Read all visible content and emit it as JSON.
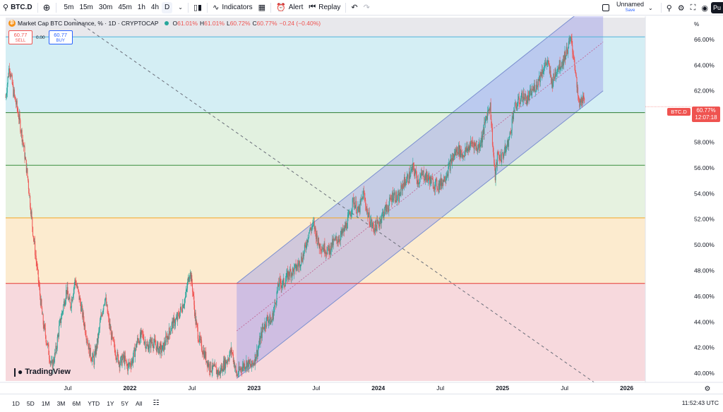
{
  "toolbar": {
    "symbol": "BTC.D",
    "intervals": [
      "5m",
      "15m",
      "30m",
      "45m",
      "1h",
      "4h",
      "D"
    ],
    "active_interval": "D",
    "indicators_label": "Indicators",
    "alert_label": "Alert",
    "replay_label": "Replay",
    "layout_name": "Unnamed",
    "save_label": "Save",
    "publish_label": "Pu"
  },
  "legend": {
    "title": "Market Cap BTC Dominance, % · 1D · CRYPTOCAP",
    "o_key": "O",
    "o_val": "61.01%",
    "h_key": "H",
    "h_val": "61.01%",
    "l_key": "L",
    "l_val": "60.72%",
    "c_key": "C",
    "c_val": "60.77%",
    "change": "−0.24 (−0.40%)"
  },
  "trade": {
    "sell_price": "60.77",
    "sell_label": "SELL",
    "spread": "0.00",
    "buy_price": "60.77",
    "buy_label": "BUY"
  },
  "watermark": "TradingView",
  "price_tag": {
    "symbol": "BTC.D",
    "value": "60.77%",
    "countdown": "12:07:18"
  },
  "bottom": {
    "ranges": [
      "1D",
      "5D",
      "1M",
      "3M",
      "6M",
      "YTD",
      "1Y",
      "5Y",
      "All"
    ],
    "utc_time": "11:52:43 UTC"
  },
  "colors": {
    "up": "#26a69a",
    "down": "#ef5350",
    "cyan_zone": "#d4eef4",
    "green_zone": "#e2f1e0",
    "orange_zone": "#fcebcf",
    "red_zone": "#f7d9dd",
    "channel_fill": "#9e9ee8",
    "channel_line": "#7b8fcf"
  },
  "chart_data": {
    "type": "candlestick",
    "unit_label": "%",
    "y_ticks": [
      "66.00%",
      "64.00%",
      "62.00%",
      "60.00%",
      "58.00%",
      "56.00%",
      "54.00%",
      "52.00%",
      "50.00%",
      "48.00%",
      "46.00%",
      "44.00%",
      "42.00%",
      "40.00%"
    ],
    "y_tick_values": [
      66,
      64,
      62,
      60,
      58,
      56,
      54,
      52,
      50,
      48,
      46,
      44,
      42,
      40
    ],
    "ylim": [
      39.4,
      67.7
    ],
    "x_ticks": [
      {
        "label": "Jul",
        "t": 2021.5
      },
      {
        "label": "2022",
        "t": 2022.0
      },
      {
        "label": "Jul",
        "t": 2022.5
      },
      {
        "label": "2023",
        "t": 2023.0
      },
      {
        "label": "Jul",
        "t": 2023.5
      },
      {
        "label": "2024",
        "t": 2024.0
      },
      {
        "label": "Jul",
        "t": 2024.5
      },
      {
        "label": "2025",
        "t": 2025.0
      },
      {
        "label": "Jul",
        "t": 2025.5
      },
      {
        "label": "2026",
        "t": 2026.0
      }
    ],
    "xlim": [
      2021.0,
      2026.15
    ],
    "horizontal_levels": [
      {
        "value": 66.2,
        "color": "#4fb3d9"
      },
      {
        "value": 60.3,
        "color": "#2e7d32"
      },
      {
        "value": 56.2,
        "color": "#388e3c"
      },
      {
        "value": 52.1,
        "color": "#f5a623"
      },
      {
        "value": 47.0,
        "color": "#e53935"
      }
    ],
    "zones": [
      {
        "from": 60.3,
        "to": 66.2,
        "color": "#d4eef4"
      },
      {
        "from": 56.2,
        "to": 60.3,
        "color": "#e2f1e0"
      },
      {
        "from": 52.1,
        "to": 56.2,
        "color": "#e6f2e0"
      },
      {
        "from": 47.0,
        "to": 52.1,
        "color": "#fcebcf"
      },
      {
        "from": 39.4,
        "to": 47.0,
        "color": "#f7d9dd"
      }
    ],
    "channel": {
      "t_start": 2022.86,
      "t_end": 2025.81,
      "upper_start": 47.0,
      "upper_end": 69.6,
      "lower_start": 39.6,
      "lower_end": 62.0
    },
    "diagonal_trend": {
      "t_start": 2021.55,
      "v_start": 67.6,
      "t_end": 2025.81,
      "v_end": 38.8
    },
    "series": [
      {
        "name": "BTC.D",
        "points": [
          [
            2021.0,
            61.5
          ],
          [
            2021.03,
            64.0
          ],
          [
            2021.06,
            62.0
          ],
          [
            2021.1,
            60.3
          ],
          [
            2021.14,
            58.0
          ],
          [
            2021.18,
            55.0
          ],
          [
            2021.22,
            51.0
          ],
          [
            2021.26,
            47.5
          ],
          [
            2021.3,
            44.0
          ],
          [
            2021.34,
            42.0
          ],
          [
            2021.37,
            40.5
          ],
          [
            2021.4,
            41.5
          ],
          [
            2021.43,
            43.5
          ],
          [
            2021.46,
            45.0
          ],
          [
            2021.49,
            46.5
          ],
          [
            2021.52,
            45.2
          ],
          [
            2021.56,
            47.3
          ],
          [
            2021.59,
            46.0
          ],
          [
            2021.62,
            44.5
          ],
          [
            2021.65,
            43.0
          ],
          [
            2021.68,
            41.5
          ],
          [
            2021.71,
            41.0
          ],
          [
            2021.74,
            42.5
          ],
          [
            2021.77,
            44.5
          ],
          [
            2021.8,
            46.0
          ],
          [
            2021.83,
            44.0
          ],
          [
            2021.86,
            42.5
          ],
          [
            2021.89,
            41.5
          ],
          [
            2021.92,
            40.8
          ],
          [
            2021.95,
            41.2
          ],
          [
            2021.98,
            40.5
          ],
          [
            2022.02,
            41.0
          ],
          [
            2022.06,
            42.5
          ],
          [
            2022.1,
            43.0
          ],
          [
            2022.14,
            42.0
          ],
          [
            2022.18,
            42.5
          ],
          [
            2022.22,
            42.0
          ],
          [
            2022.26,
            41.8
          ],
          [
            2022.3,
            42.8
          ],
          [
            2022.34,
            43.8
          ],
          [
            2022.38,
            44.2
          ],
          [
            2022.42,
            45.2
          ],
          [
            2022.45,
            46.0
          ],
          [
            2022.48,
            48.0
          ],
          [
            2022.5,
            47.0
          ],
          [
            2022.53,
            44.0
          ],
          [
            2022.56,
            42.5
          ],
          [
            2022.6,
            41.5
          ],
          [
            2022.64,
            40.5
          ],
          [
            2022.68,
            40.3
          ],
          [
            2022.72,
            40.0
          ],
          [
            2022.75,
            40.6
          ],
          [
            2022.78,
            41.0
          ],
          [
            2022.82,
            41.8
          ],
          [
            2022.86,
            39.8
          ],
          [
            2022.9,
            40.5
          ],
          [
            2022.94,
            40.8
          ],
          [
            2022.98,
            40.5
          ],
          [
            2023.03,
            41.8
          ],
          [
            2023.07,
            43.5
          ],
          [
            2023.11,
            44.3
          ],
          [
            2023.14,
            44.0
          ],
          [
            2023.17,
            45.5
          ],
          [
            2023.2,
            47.0
          ],
          [
            2023.24,
            47.0
          ],
          [
            2023.28,
            47.8
          ],
          [
            2023.32,
            48.0
          ],
          [
            2023.36,
            48.5
          ],
          [
            2023.4,
            49.3
          ],
          [
            2023.44,
            51.0
          ],
          [
            2023.48,
            51.6
          ],
          [
            2023.52,
            50.0
          ],
          [
            2023.56,
            49.8
          ],
          [
            2023.6,
            49.5
          ],
          [
            2023.64,
            50.2
          ],
          [
            2023.68,
            50.5
          ],
          [
            2023.72,
            51.0
          ],
          [
            2023.76,
            52.0
          ],
          [
            2023.8,
            53.5
          ],
          [
            2023.84,
            52.5
          ],
          [
            2023.88,
            54.0
          ],
          [
            2023.92,
            52.2
          ],
          [
            2023.96,
            51.3
          ],
          [
            2024.0,
            51.6
          ],
          [
            2024.04,
            52.5
          ],
          [
            2024.08,
            53.0
          ],
          [
            2024.12,
            54.0
          ],
          [
            2024.16,
            53.5
          ],
          [
            2024.2,
            54.8
          ],
          [
            2024.24,
            55.2
          ],
          [
            2024.28,
            56.0
          ],
          [
            2024.32,
            55.0
          ],
          [
            2024.36,
            55.5
          ],
          [
            2024.4,
            55.2
          ],
          [
            2024.44,
            54.8
          ],
          [
            2024.48,
            54.6
          ],
          [
            2024.52,
            55.0
          ],
          [
            2024.56,
            55.8
          ],
          [
            2024.6,
            56.8
          ],
          [
            2024.64,
            57.5
          ],
          [
            2024.68,
            57.0
          ],
          [
            2024.72,
            57.5
          ],
          [
            2024.76,
            58.0
          ],
          [
            2024.8,
            57.5
          ],
          [
            2024.84,
            58.5
          ],
          [
            2024.87,
            60.0
          ],
          [
            2024.9,
            61.0
          ],
          [
            2024.92,
            58.0
          ],
          [
            2024.94,
            55.2
          ],
          [
            2024.96,
            57.0
          ],
          [
            2024.99,
            56.8
          ],
          [
            2025.03,
            57.5
          ],
          [
            2025.06,
            58.5
          ],
          [
            2025.09,
            60.5
          ],
          [
            2025.12,
            61.0
          ],
          [
            2025.16,
            61.6
          ],
          [
            2025.2,
            61.3
          ],
          [
            2025.24,
            62.0
          ],
          [
            2025.28,
            62.6
          ],
          [
            2025.32,
            63.6
          ],
          [
            2025.36,
            64.3
          ],
          [
            2025.4,
            62.6
          ],
          [
            2025.44,
            63.8
          ],
          [
            2025.48,
            64.2
          ],
          [
            2025.52,
            65.2
          ],
          [
            2025.55,
            66.0
          ],
          [
            2025.58,
            64.3
          ],
          [
            2025.6,
            62.0
          ],
          [
            2025.62,
            60.8
          ],
          [
            2025.64,
            61.5
          ],
          [
            2025.66,
            60.9
          ]
        ]
      }
    ]
  }
}
